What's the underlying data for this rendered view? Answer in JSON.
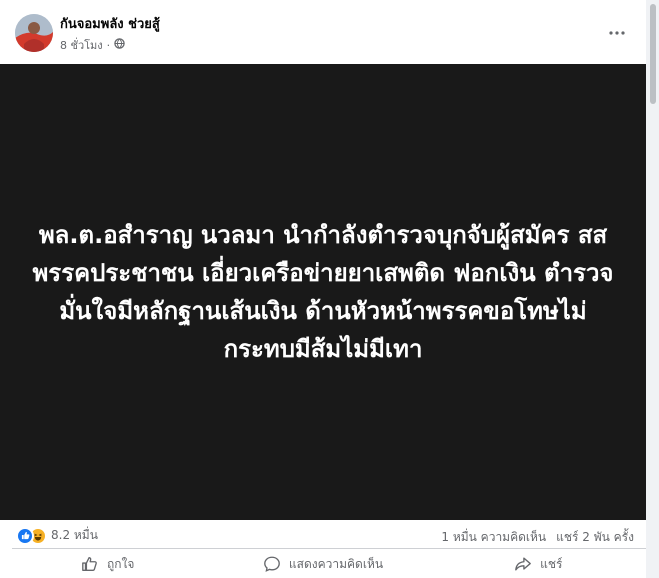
{
  "post": {
    "page_name": "กันจอมพลัง ช่วยสู้",
    "time": "8 ชั่วโมง",
    "privacy_icon": "globe-icon",
    "image_text": "พล.ต.อสำราญ นวลมา นำกำลังตำรวจบุกจับผู้สมัคร สส พรรคประชาชน เอี่ยวเครือข่ายยาเสพติด ฟอกเงิน ตำรวจมั่นใจมีหลักฐานเส้นเงิน ด้านหัวหน้าพรรคขอโทษไม่กระทบมีส้มไม่มีเทา"
  },
  "stats": {
    "reaction_icons": [
      "like-icon",
      "haha-icon"
    ],
    "reaction_count": "8.2 หมื่น",
    "comments": "1 หมื่น ความคิดเห็น",
    "shares": "แชร์ 2 พัน ครั้ง"
  },
  "actions": {
    "like": "ถูกใจ",
    "comment": "แสดงความคิดเห็น",
    "share": "แชร์"
  },
  "colors": {
    "image_background": "#191919",
    "like_blue": "#1877f2",
    "haha_yellow": "#f7b125",
    "muted_text": "#65676b"
  }
}
